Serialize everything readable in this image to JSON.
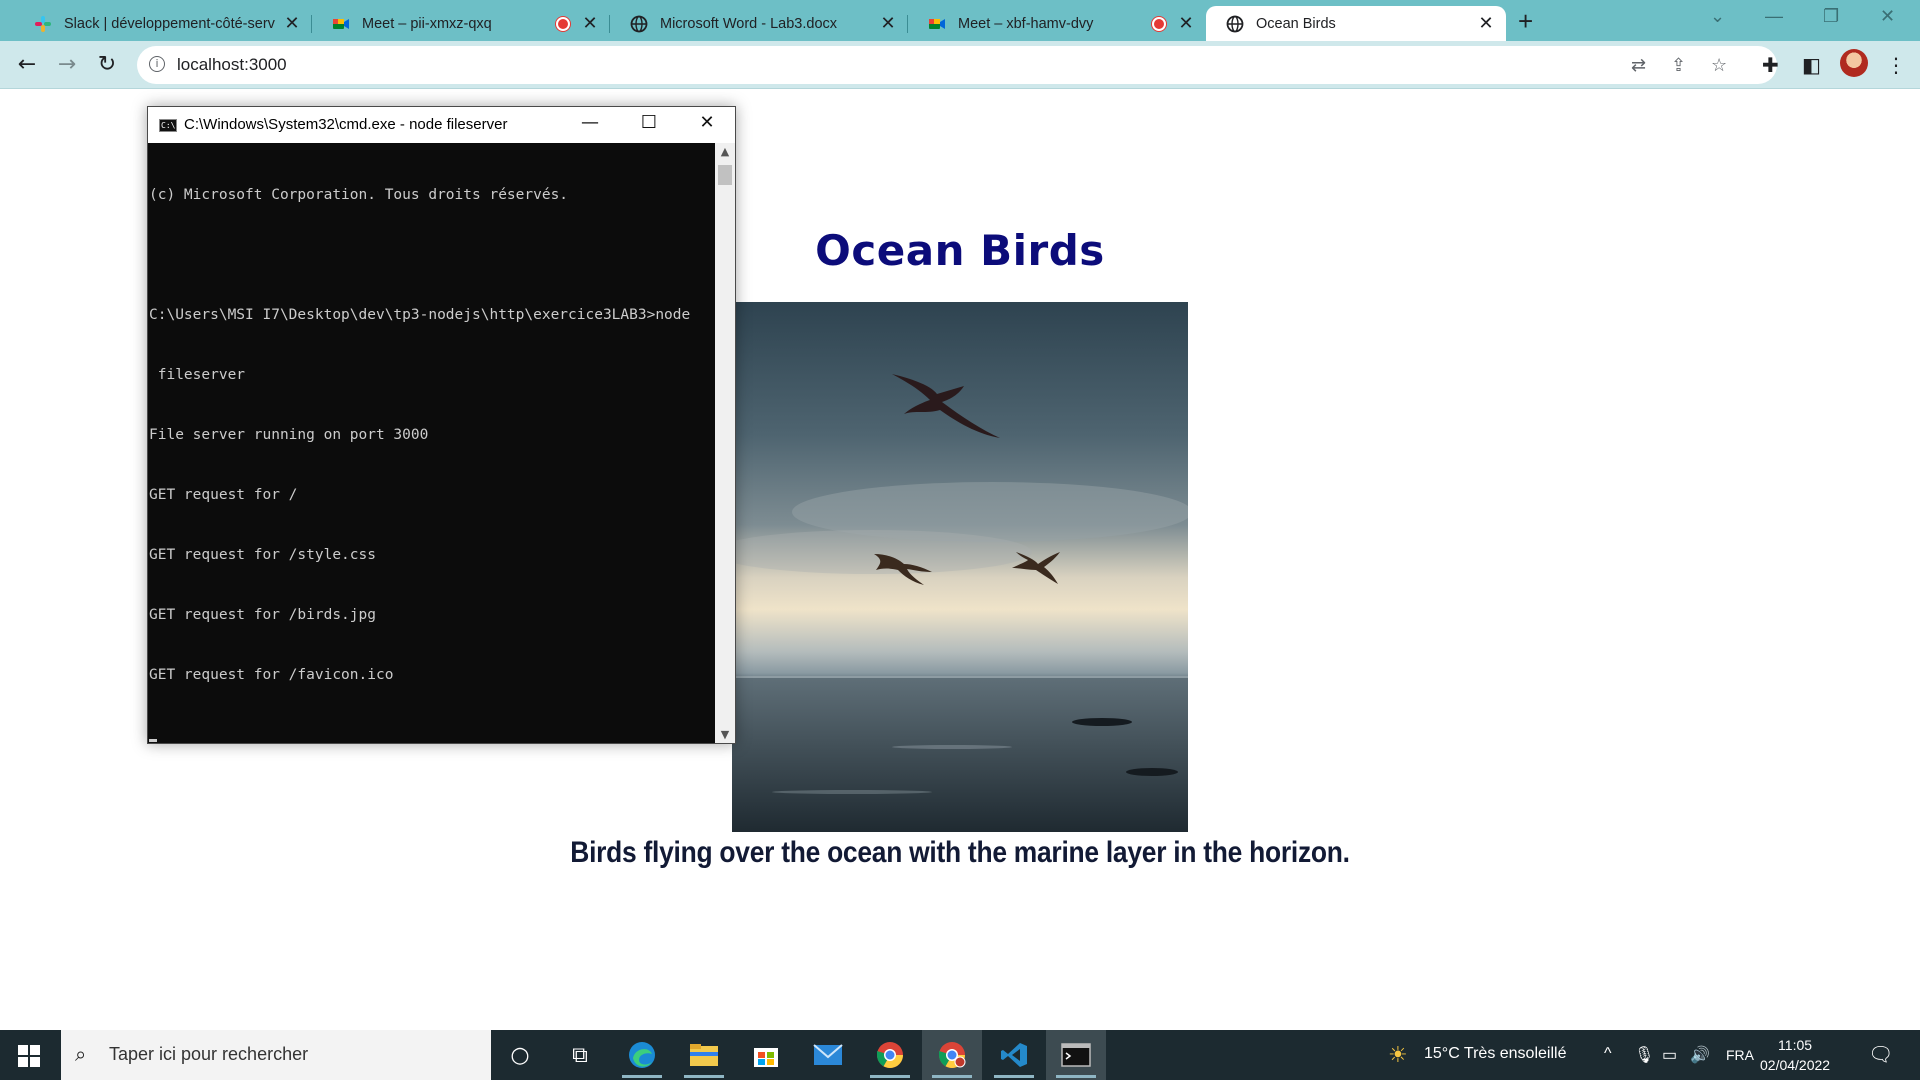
{
  "browser": {
    "tabs": [
      {
        "title": "Slack | développement-côté-serv",
        "favicon": "slack-icon",
        "close": "✕"
      },
      {
        "title": "Meet – pii-xmxz-qxq",
        "favicon": "google-meet-icon",
        "close": "✕"
      },
      {
        "title": "Microsoft Word - Lab3.docx",
        "favicon": "globe-icon",
        "close": "✕"
      },
      {
        "title": "Meet – xbf-hamv-dvy",
        "favicon": "google-meet-icon",
        "close": "✕"
      },
      {
        "title": "Ocean Birds",
        "favicon": "globe-icon",
        "close": "✕",
        "active": true
      }
    ],
    "new_tab": "+",
    "window_controls": {
      "tab_search": "⌄",
      "minimize": "—",
      "restore": "❐",
      "close": "✕"
    },
    "address_bar": {
      "url": "localhost:3000"
    },
    "nav": {
      "back": "←",
      "forward": "→",
      "reload": "↻"
    }
  },
  "page": {
    "title": "Ocean Birds",
    "image_alt": "birds.jpg",
    "caption": "Birds flying over the ocean with the marine layer in the horizon."
  },
  "cmd": {
    "title": "C:\\Windows\\System32\\cmd.exe - node  fileserver",
    "icon_text": "C:\\",
    "lines": [
      "(c) Microsoft Corporation. Tous droits réservés.",
      "",
      "C:\\Users\\MSI I7\\Desktop\\dev\\tp3-nodejs\\http\\exercice3LAB3>node",
      " fileserver",
      "File server running on port 3000",
      "GET request for /",
      "GET request for /style.css",
      "GET request for /birds.jpg",
      "GET request for /favicon.ico"
    ],
    "controls": {
      "minimize": "—",
      "maximize": "☐",
      "close": "✕"
    }
  },
  "taskbar": {
    "search_placeholder": "Taper ici pour rechercher",
    "weather": "15°C  Très ensoleillé",
    "language": "FRA",
    "time": "11:05",
    "date": "02/04/2022"
  },
  "colors": {
    "tabstrip": "#6dbfc6",
    "toolbar": "#cfe8eb",
    "page_title": "#0c0c7a",
    "caption": "#121a35",
    "taskbar": "#1c2a30"
  }
}
